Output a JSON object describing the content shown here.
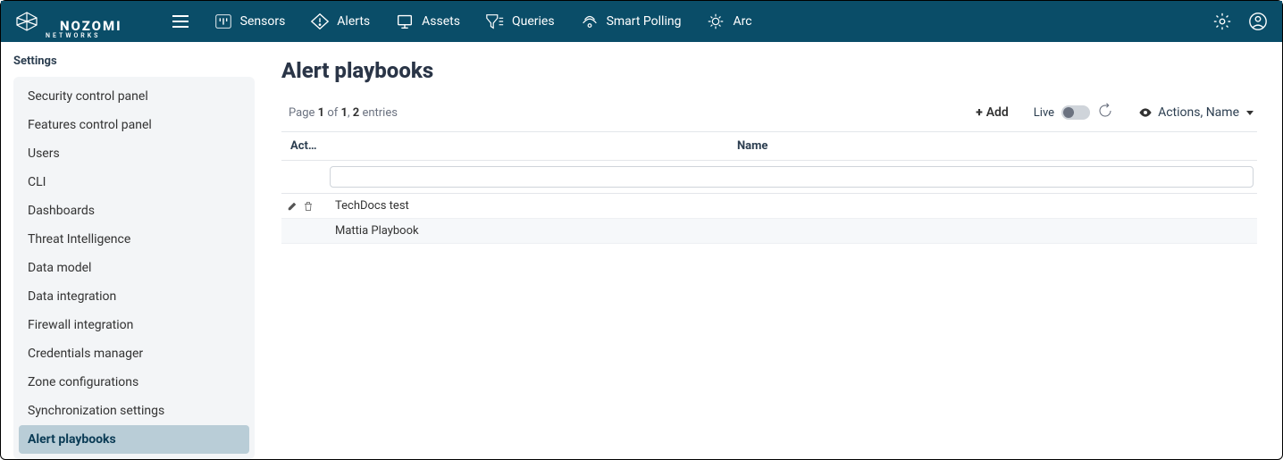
{
  "brand": {
    "name": "NOZOMI",
    "subtitle": "NETWORKS"
  },
  "nav": {
    "items": [
      {
        "label": "Sensors"
      },
      {
        "label": "Alerts"
      },
      {
        "label": "Assets"
      },
      {
        "label": "Queries"
      },
      {
        "label": "Smart Polling"
      },
      {
        "label": "Arc"
      }
    ]
  },
  "sidebar": {
    "title": "Settings",
    "items": [
      {
        "label": "Security control panel"
      },
      {
        "label": "Features control panel"
      },
      {
        "label": "Users"
      },
      {
        "label": "CLI"
      },
      {
        "label": "Dashboards"
      },
      {
        "label": "Threat Intelligence"
      },
      {
        "label": "Data model"
      },
      {
        "label": "Data integration"
      },
      {
        "label": "Firewall integration"
      },
      {
        "label": "Credentials manager"
      },
      {
        "label": "Zone configurations"
      },
      {
        "label": "Synchronization settings"
      },
      {
        "label": "Alert playbooks"
      }
    ],
    "active_index": 12
  },
  "main": {
    "title": "Alert playbooks",
    "page_info": {
      "prefix": "Page ",
      "page": "1",
      "of": " of ",
      "total_pages": "1",
      "sep": ", ",
      "entries": "2",
      "suffix": " entries"
    },
    "toolbar": {
      "add_label": "Add",
      "live_label": "Live",
      "columns_label": "Actions, Name"
    },
    "table": {
      "headers": {
        "actions": "Acti...",
        "name": "Name"
      },
      "filter": {
        "name_value": ""
      },
      "rows": [
        {
          "name": "TechDocs test",
          "show_actions": true
        },
        {
          "name": "Mattia Playbook",
          "show_actions": false
        }
      ]
    }
  }
}
